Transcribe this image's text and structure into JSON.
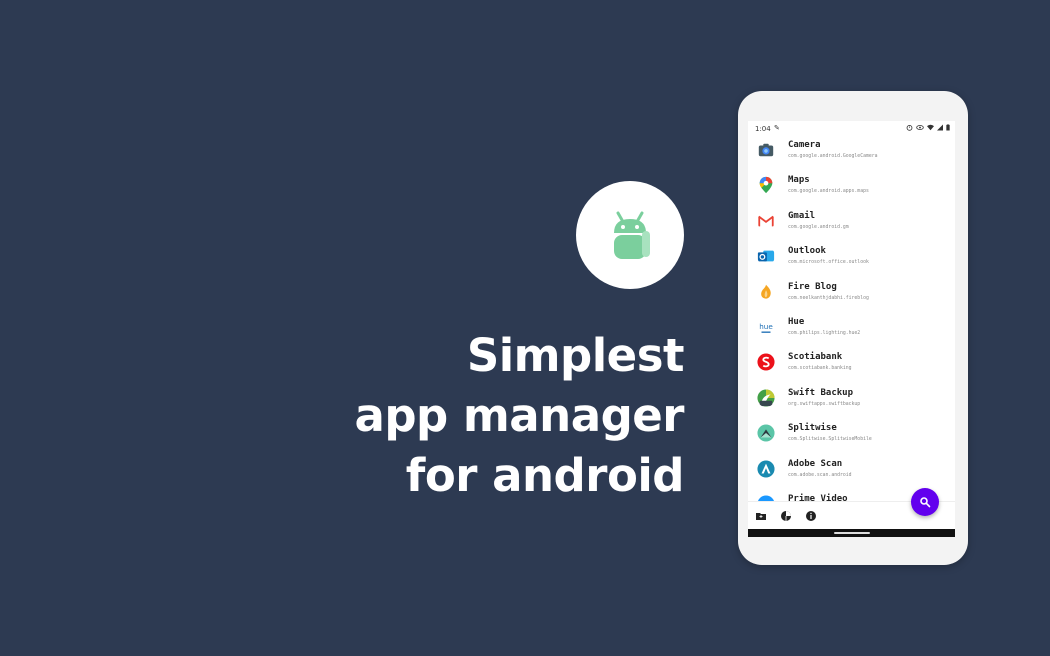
{
  "headline": {
    "line1": "Simplest",
    "line2": "app manager",
    "line3": "for android"
  },
  "logo": {
    "icon": "android-robot-icon",
    "color": "#7bcf9d"
  },
  "status_bar": {
    "time": "1:04"
  },
  "apps": [
    {
      "name": "Camera",
      "package": "com.google.android.GoogleCamera",
      "icon": "camera-icon"
    },
    {
      "name": "Maps",
      "package": "com.google.android.apps.maps",
      "icon": "maps-pin-icon"
    },
    {
      "name": "Gmail",
      "package": "com.google.android.gm",
      "icon": "gmail-icon"
    },
    {
      "name": "Outlook",
      "package": "com.microsoft.office.outlook",
      "icon": "outlook-icon"
    },
    {
      "name": "Fire Blog",
      "package": "com.neelkanthjdabhi.fireblog",
      "icon": "fire-blog-icon"
    },
    {
      "name": "Hue",
      "package": "com.philips.lighting.hue2",
      "icon": "hue-icon",
      "icon_text": "hue"
    },
    {
      "name": "Scotiabank",
      "package": "com.scotiabank.banking",
      "icon": "scotiabank-icon"
    },
    {
      "name": "Swift Backup",
      "package": "org.swiftapps.swiftbackup",
      "icon": "swift-backup-icon"
    },
    {
      "name": "Splitwise",
      "package": "com.Splitwise.SplitwiseMobile",
      "icon": "splitwise-icon"
    },
    {
      "name": "Adobe Scan",
      "package": "com.adobe.scan.android",
      "icon": "adobe-scan-icon"
    },
    {
      "name": "Prime Video",
      "package": "",
      "icon": "prime-video-icon"
    }
  ],
  "bottom_nav": [
    {
      "icon": "folder-icon"
    },
    {
      "icon": "pie-chart-icon"
    },
    {
      "icon": "info-icon"
    }
  ],
  "fab": {
    "icon": "search-icon",
    "color": "#6200ee"
  },
  "colors": {
    "background": "#2d3a52",
    "accent": "#6200ee"
  }
}
